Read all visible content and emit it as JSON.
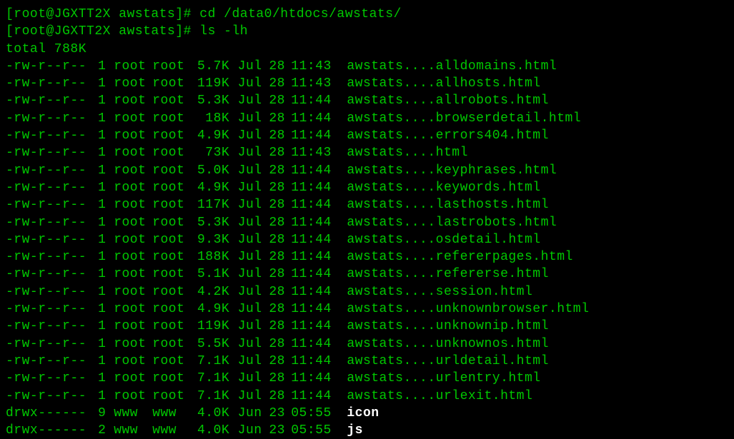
{
  "prompts": [
    {
      "user_host": "[root@JGXTT2X awstats]#",
      "command": "cd /data0/htdocs/awstats/"
    },
    {
      "user_host": "[root@JGXTT2X awstats]#",
      "command": "ls -lh"
    }
  ],
  "total": "total 788K",
  "entries": [
    {
      "perms": "-rw-r--r--",
      "links": "1",
      "owner": "root",
      "group": "root",
      "size": "5.7K",
      "month": "Jul",
      "day": "28",
      "time": "11:43",
      "name": "awstats....alldomains.html",
      "is_dir": false
    },
    {
      "perms": "-rw-r--r--",
      "links": "1",
      "owner": "root",
      "group": "root",
      "size": "119K",
      "month": "Jul",
      "day": "28",
      "time": "11:43",
      "name": "awstats....allhosts.html",
      "is_dir": false
    },
    {
      "perms": "-rw-r--r--",
      "links": "1",
      "owner": "root",
      "group": "root",
      "size": "5.3K",
      "month": "Jul",
      "day": "28",
      "time": "11:44",
      "name": "awstats....allrobots.html",
      "is_dir": false
    },
    {
      "perms": "-rw-r--r--",
      "links": "1",
      "owner": "root",
      "group": "root",
      "size": "18K",
      "month": "Jul",
      "day": "28",
      "time": "11:44",
      "name": "awstats....browserdetail.html",
      "is_dir": false
    },
    {
      "perms": "-rw-r--r--",
      "links": "1",
      "owner": "root",
      "group": "root",
      "size": "4.9K",
      "month": "Jul",
      "day": "28",
      "time": "11:44",
      "name": "awstats....errors404.html",
      "is_dir": false
    },
    {
      "perms": "-rw-r--r--",
      "links": "1",
      "owner": "root",
      "group": "root",
      "size": "73K",
      "month": "Jul",
      "day": "28",
      "time": "11:43",
      "name": "awstats....html",
      "is_dir": false
    },
    {
      "perms": "-rw-r--r--",
      "links": "1",
      "owner": "root",
      "group": "root",
      "size": "5.0K",
      "month": "Jul",
      "day": "28",
      "time": "11:44",
      "name": "awstats....keyphrases.html",
      "is_dir": false
    },
    {
      "perms": "-rw-r--r--",
      "links": "1",
      "owner": "root",
      "group": "root",
      "size": "4.9K",
      "month": "Jul",
      "day": "28",
      "time": "11:44",
      "name": "awstats....keywords.html",
      "is_dir": false
    },
    {
      "perms": "-rw-r--r--",
      "links": "1",
      "owner": "root",
      "group": "root",
      "size": "117K",
      "month": "Jul",
      "day": "28",
      "time": "11:44",
      "name": "awstats....lasthosts.html",
      "is_dir": false
    },
    {
      "perms": "-rw-r--r--",
      "links": "1",
      "owner": "root",
      "group": "root",
      "size": "5.3K",
      "month": "Jul",
      "day": "28",
      "time": "11:44",
      "name": "awstats....lastrobots.html",
      "is_dir": false
    },
    {
      "perms": "-rw-r--r--",
      "links": "1",
      "owner": "root",
      "group": "root",
      "size": "9.3K",
      "month": "Jul",
      "day": "28",
      "time": "11:44",
      "name": "awstats....osdetail.html",
      "is_dir": false
    },
    {
      "perms": "-rw-r--r--",
      "links": "1",
      "owner": "root",
      "group": "root",
      "size": "188K",
      "month": "Jul",
      "day": "28",
      "time": "11:44",
      "name": "awstats....refererpages.html",
      "is_dir": false
    },
    {
      "perms": "-rw-r--r--",
      "links": "1",
      "owner": "root",
      "group": "root",
      "size": "5.1K",
      "month": "Jul",
      "day": "28",
      "time": "11:44",
      "name": "awstats....refererse.html",
      "is_dir": false
    },
    {
      "perms": "-rw-r--r--",
      "links": "1",
      "owner": "root",
      "group": "root",
      "size": "4.2K",
      "month": "Jul",
      "day": "28",
      "time": "11:44",
      "name": "awstats....session.html",
      "is_dir": false
    },
    {
      "perms": "-rw-r--r--",
      "links": "1",
      "owner": "root",
      "group": "root",
      "size": "4.9K",
      "month": "Jul",
      "day": "28",
      "time": "11:44",
      "name": "awstats....unknownbrowser.html",
      "is_dir": false
    },
    {
      "perms": "-rw-r--r--",
      "links": "1",
      "owner": "root",
      "group": "root",
      "size": "119K",
      "month": "Jul",
      "day": "28",
      "time": "11:44",
      "name": "awstats....unknownip.html",
      "is_dir": false
    },
    {
      "perms": "-rw-r--r--",
      "links": "1",
      "owner": "root",
      "group": "root",
      "size": "5.5K",
      "month": "Jul",
      "day": "28",
      "time": "11:44",
      "name": "awstats....unknownos.html",
      "is_dir": false
    },
    {
      "perms": "-rw-r--r--",
      "links": "1",
      "owner": "root",
      "group": "root",
      "size": "7.1K",
      "month": "Jul",
      "day": "28",
      "time": "11:44",
      "name": "awstats....urldetail.html",
      "is_dir": false
    },
    {
      "perms": "-rw-r--r--",
      "links": "1",
      "owner": "root",
      "group": "root",
      "size": "7.1K",
      "month": "Jul",
      "day": "28",
      "time": "11:44",
      "name": "awstats....urlentry.html",
      "is_dir": false
    },
    {
      "perms": "-rw-r--r--",
      "links": "1",
      "owner": "root",
      "group": "root",
      "size": "7.1K",
      "month": "Jul",
      "day": "28",
      "time": "11:44",
      "name": "awstats....urlexit.html",
      "is_dir": false
    },
    {
      "perms": "drwx------",
      "links": "9",
      "owner": "www",
      "group": "www",
      "size": "4.0K",
      "month": "Jun",
      "day": "23",
      "time": "05:55",
      "name": "icon",
      "is_dir": true
    },
    {
      "perms": "drwx------",
      "links": "2",
      "owner": "www",
      "group": "www",
      "size": "4.0K",
      "month": "Jun",
      "day": "23",
      "time": "05:55",
      "name": "js",
      "is_dir": true
    }
  ]
}
